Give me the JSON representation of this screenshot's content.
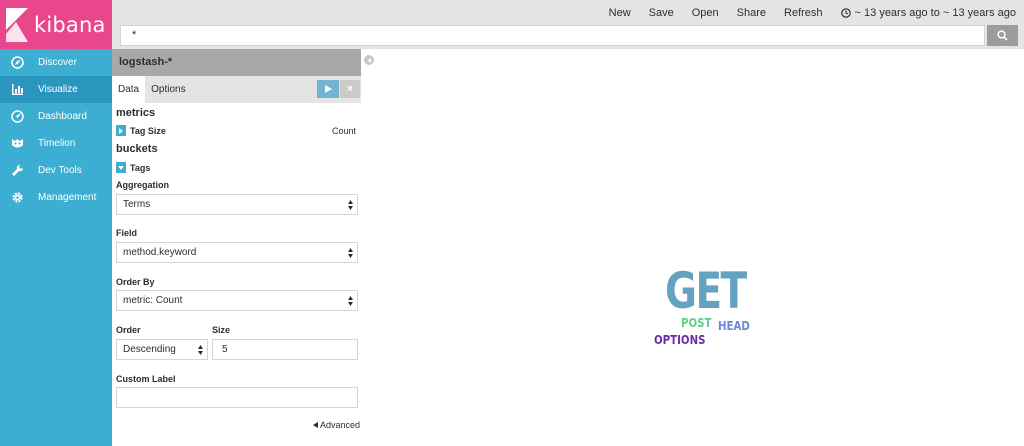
{
  "app": {
    "name": "kibana"
  },
  "nav": [
    {
      "label": "Discover",
      "icon": "compass-icon"
    },
    {
      "label": "Visualize",
      "icon": "bar-chart-icon",
      "active": true
    },
    {
      "label": "Dashboard",
      "icon": "dashboard-icon"
    },
    {
      "label": "Timelion",
      "icon": "timelion-icon"
    },
    {
      "label": "Dev Tools",
      "icon": "wrench-icon"
    },
    {
      "label": "Management",
      "icon": "gear-icon"
    }
  ],
  "toolbar": {
    "new": "New",
    "save": "Save",
    "open": "Open",
    "share": "Share",
    "refresh": "Refresh",
    "time_range": "~ 13 years ago to ~ 13 years ago"
  },
  "query": {
    "value": "*"
  },
  "editor": {
    "index_pattern": "logstash-*",
    "tabs": [
      "Data",
      "Options"
    ],
    "metrics_title": "metrics",
    "metric_label": "Tag Size",
    "metric_value": "Count",
    "buckets_title": "buckets",
    "bucket_label": "Tags",
    "aggregation_label": "Aggregation",
    "aggregation_value": "Terms",
    "field_label": "Field",
    "field_value": "method.keyword",
    "order_by_label": "Order By",
    "order_by_value": "metric: Count",
    "order_label": "Order",
    "order_value": "Descending",
    "size_label": "Size",
    "size_value": "5",
    "custom_label_label": "Custom Label",
    "custom_label_value": "",
    "advanced_label": "Advanced"
  },
  "colors": {
    "sidebar": "#3caed2",
    "logo": "#e8478b",
    "active_nav": "#2b96bd"
  },
  "tags": [
    {
      "text": "GET",
      "color": "#64a2c2"
    },
    {
      "text": "POST",
      "color": "#5fcf86"
    },
    {
      "text": "HEAD",
      "color": "#6e87d6"
    },
    {
      "text": "OPTIONS",
      "color": "#6a2fa8"
    }
  ]
}
